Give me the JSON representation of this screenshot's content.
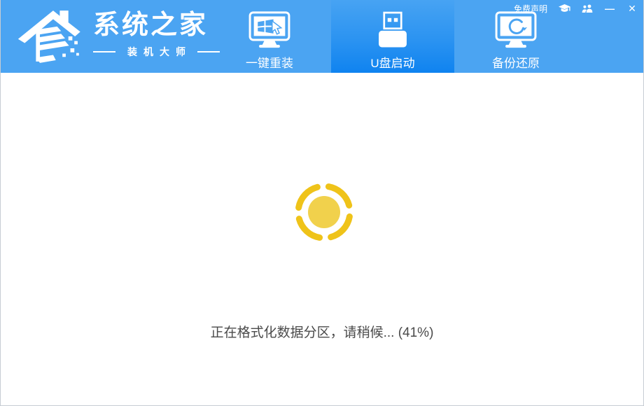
{
  "header": {
    "logo": {
      "title": "系统之家",
      "subtitle": "装机大师"
    },
    "links": {
      "disclaimer": "免费声明"
    },
    "icons": {
      "tutorial": "graduation-cap-icon",
      "group": "users-icon"
    },
    "tabs": [
      {
        "id": "reinstall",
        "label": "一键重装",
        "icon": "monitor-windows-icon",
        "active": false
      },
      {
        "id": "usb-boot",
        "label": "U盘启动",
        "icon": "usb-drive-icon",
        "active": true
      },
      {
        "id": "backup-restore",
        "label": "备份还原",
        "icon": "monitor-restore-icon",
        "active": false
      }
    ]
  },
  "window_controls": {
    "minimize": "—",
    "close": "✕"
  },
  "main": {
    "status_text": "正在格式化数据分区，请稍候... (41%)",
    "progress_percent": 41
  },
  "colors": {
    "header_blue": "#4BA4F2",
    "active_tab_gradient_top": "#47A3F3",
    "active_tab_gradient_bottom": "#0F83F0",
    "spinner_arc": "#EFC319",
    "spinner_core": "#F1D14C",
    "status_text": "#4A4A4A",
    "window_border": "#C6CCD3"
  }
}
